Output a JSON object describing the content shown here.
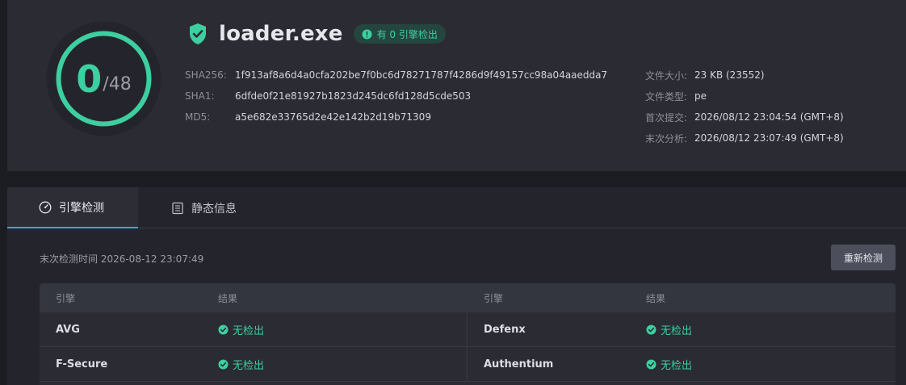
{
  "score": {
    "detected": "0",
    "total": "/48",
    "ratio": 0,
    "ring_color": "#3dcf9f"
  },
  "file": {
    "name": "loader.exe",
    "status_icon": "shield-check-icon",
    "badge": "有 0 引擎检出"
  },
  "hashes": [
    {
      "label": "SHA256:",
      "value": "1f913af8a6d4a0cfa202be7f0bc6d78271787f4286d9f49157cc98a04aaedda7"
    },
    {
      "label": "SHA1:",
      "value": "6dfde0f21e81927b1823d245dc6fd128d5cde503"
    },
    {
      "label": "MD5:",
      "value": "a5e682e33765d2e42e142b2d19b71309"
    }
  ],
  "meta": [
    {
      "label": "文件大小:",
      "value": "23 KB (23552)"
    },
    {
      "label": "文件类型:",
      "value": "pe"
    },
    {
      "label": "首次提交:",
      "value": "2026/08/12 23:04:54 (GMT+8)"
    },
    {
      "label": "末次分析:",
      "value": "2026/08/12 23:07:49 (GMT+8)"
    }
  ],
  "tabs": [
    {
      "label": "引擎检测",
      "icon": "gauge-icon",
      "active": true
    },
    {
      "label": "静态信息",
      "icon": "document-list-icon",
      "active": false
    }
  ],
  "scan": {
    "last_scan": "末次检测时间 2026-08-12 23:07:49",
    "rescan_label": "重新检测"
  },
  "table": {
    "headers": [
      "引擎",
      "结果",
      "引擎",
      "结果"
    ],
    "rows": [
      [
        {
          "engine": "AVG",
          "result": "无检出"
        },
        {
          "engine": "Defenx",
          "result": "无检出"
        }
      ],
      [
        {
          "engine": "F-Secure",
          "result": "无检出"
        },
        {
          "engine": "Authentium",
          "result": "无检出"
        }
      ]
    ]
  },
  "colors": {
    "accent_green": "#3dcf9f",
    "tab_underline": "#3ba4e0",
    "background": "#1c1d23"
  }
}
